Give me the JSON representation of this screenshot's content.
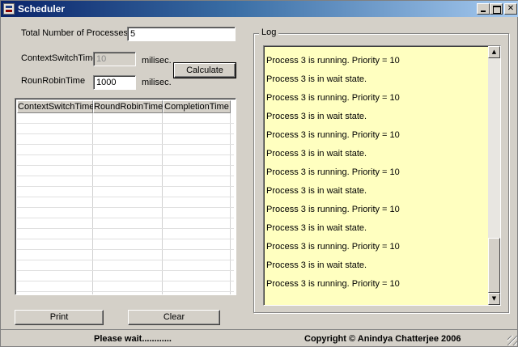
{
  "window": {
    "title": "Scheduler"
  },
  "form": {
    "total_label": "Total Number of Processes",
    "total_value": "5",
    "cst_label": "ContextSwitchTime",
    "cst_value": "10",
    "cst_unit": "milisec.",
    "rr_label": "RounRobinTime",
    "rr_value": "1000",
    "rr_unit": "milisec.",
    "calculate_label": "Calculate"
  },
  "grid": {
    "columns": [
      "ContextSwitchTime",
      "RoundRobinTime",
      "CompletionTime"
    ],
    "rows": []
  },
  "log": {
    "legend": "Log",
    "lines": [
      "Process 3 is running. Priority = 10",
      "Process 3 is in wait state.",
      "Process 3 is running. Priority = 10",
      "Process 3 is in wait state.",
      "Process 3 is running. Priority = 10",
      "Process 3 is in wait state.",
      "Process 3 is running. Priority = 10",
      "Process 3 is in wait state.",
      "Process 3 is running. Priority = 10",
      "Process 3 is in wait state.",
      "Process 3 is running. Priority = 10",
      "Process 3 is in wait state.",
      "Process 3 is running. Priority = 10"
    ]
  },
  "buttons": {
    "print": "Print",
    "clear": "Clear"
  },
  "status": {
    "message": "Please wait............",
    "copyright": "Copyright © Anindya Chatterjee 2006"
  }
}
